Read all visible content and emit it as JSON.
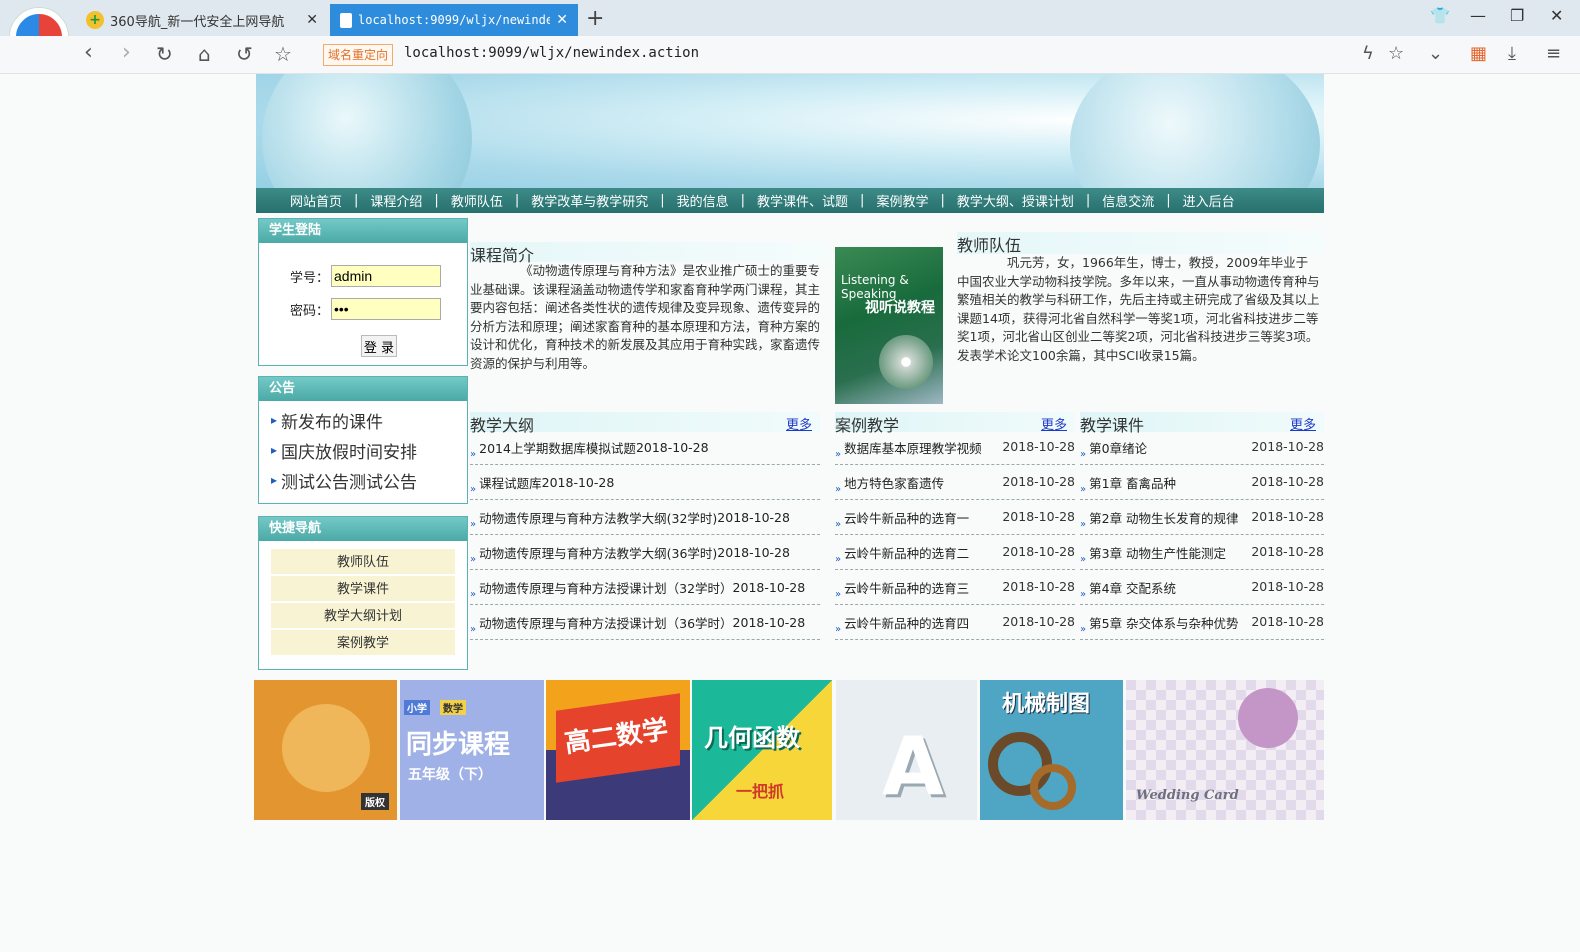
{
  "browser": {
    "tabs": [
      {
        "title": "360导航_新一代安全上网导航",
        "active": false
      },
      {
        "title": "localhost:9099/wljx/newindex",
        "active": true
      }
    ],
    "redirect_badge": "域名重定向",
    "url": "localhost:9099/wljx/newindex.action"
  },
  "menu": [
    "网站首页",
    "课程介绍",
    "教师队伍",
    "教学改革与教学研究",
    "我的信息",
    "教学课件、试题",
    "案例教学",
    "教学大纲、授课计划",
    "信息交流",
    "进入后台"
  ],
  "login": {
    "title": "学生登陆",
    "id_label": "学号：",
    "id_value": "admin",
    "pw_label": "密码：",
    "pw_value": "•••",
    "button": "登 录"
  },
  "notice": {
    "title": "公告",
    "items": [
      "新发布的课件",
      "国庆放假时间安排",
      "测试公告测试公告"
    ]
  },
  "quick": {
    "title": "快捷导航",
    "items": [
      "教师队伍",
      "教学课件",
      "教学大纲计划",
      "案例教学"
    ]
  },
  "intro": {
    "title": "课程简介",
    "text": "《动物遗传原理与育种方法》是农业推广硕士的重要专业基础课。该课程涵盖动物遗传学和家畜育种学两门课程，其主要内容包括：阐述各类性状的遗传规律及变异现象、遗传变异的分析方法和原理；阐述家畜育种的基本原理和方法，育种方案的设计和优化，育种技术的新发展及其应用于育种实践，家畜遗传资源的保护与利用等。"
  },
  "book": {
    "line1": "Listening & Speaking",
    "title": "视听说教程"
  },
  "team": {
    "title": "教师队伍",
    "text": "巩元芳，女，1966年生，博士，教授，2009年毕业于中国农业大学动物科技学院。多年以来，一直从事动物遗传育种与繁殖相关的教学与科研工作，先后主持或主研完成了省级及其以上课题14项，获得河北省自然科学一等奖1项，河北省科技进步二等奖1项，河北省山区创业二等奖2项，河北省科技进步三等奖3项。发表学术论文100余篇，其中SCI收录15篇。"
  },
  "lists": {
    "more_label": "更多",
    "syllabus": {
      "title": "教学大纲",
      "items": [
        {
          "text": "2014上学期数据库模拟试题",
          "date": "2018-10-28"
        },
        {
          "text": "课程试题库",
          "date": "2018-10-28"
        },
        {
          "text": "动物遗传原理与育种方法教学大纲(32学时)",
          "date": "2018-10-28"
        },
        {
          "text": "动物遗传原理与育种方法教学大纲(36学时)",
          "date": "2018-10-28"
        },
        {
          "text": "动物遗传原理与育种方法授课计划（32学时）",
          "date": "2018-10-28"
        },
        {
          "text": "动物遗传原理与育种方法授课计划（36学时）",
          "date": "2018-10-28"
        }
      ]
    },
    "cases": {
      "title": "案例教学",
      "items": [
        {
          "text": "数据库基本原理教学视频",
          "date": "2018-10-28"
        },
        {
          "text": "地方特色家畜遗传",
          "date": "2018-10-28"
        },
        {
          "text": "云岭牛新品种的选育一",
          "date": "2018-10-28"
        },
        {
          "text": "云岭牛新品种的选育二",
          "date": "2018-10-28"
        },
        {
          "text": "云岭牛新品种的选育三",
          "date": "2018-10-28"
        },
        {
          "text": "云岭牛新品种的选育四",
          "date": "2018-10-28"
        }
      ]
    },
    "courseware": {
      "title": "教学课件",
      "items": [
        {
          "text": "第0章绪论",
          "date": "2018-10-28"
        },
        {
          "text": "第1章 畜禽品种",
          "date": "2018-10-28"
        },
        {
          "text": "第2章 动物生长发育的规律",
          "date": "2018-10-28"
        },
        {
          "text": "第3章 动物生产性能测定",
          "date": "2018-10-28"
        },
        {
          "text": "第4章 交配系统",
          "date": "2018-10-28"
        },
        {
          "text": "第5章 杂交体系与杂种优势",
          "date": "2018-10-28"
        }
      ]
    }
  },
  "thumbs": [
    {
      "label": "版权",
      "color": "#e3962f"
    },
    {
      "label": "同步课程",
      "tag1": "小学",
      "tag2": "数学",
      "sub": "五年级（下）",
      "color": "#9fb1e6"
    },
    {
      "label": "高二数学",
      "color": "#f3a21c"
    },
    {
      "label": "几何函数",
      "sub": "一把抓",
      "color": "#1bb89a"
    },
    {
      "label": "A",
      "color": "#e8eef2"
    },
    {
      "label": "机械制图",
      "color": "#4fa5c4"
    },
    {
      "label": "Wedding Card",
      "color": "#f2eef4"
    }
  ]
}
